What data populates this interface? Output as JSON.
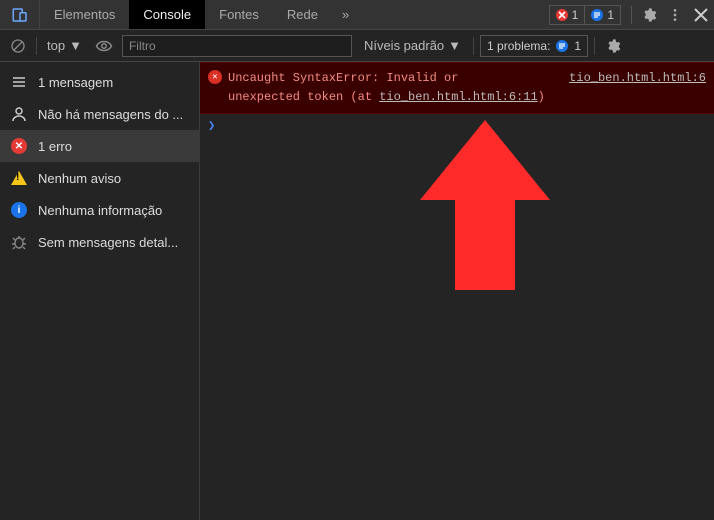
{
  "tabs": {
    "elements": "Elementos",
    "console": "Console",
    "sources": "Fontes",
    "network": "Rede",
    "more": "»"
  },
  "badges": {
    "errors": "1",
    "issues": "1"
  },
  "toolbar": {
    "context": "top",
    "filter_placeholder": "Filtro",
    "levels": "Níveis padrão",
    "issues_label": "1 problema:",
    "issues_count": "1"
  },
  "sidebar": {
    "items": [
      {
        "label": "1 mensagem"
      },
      {
        "label": "Não há mensagens do ..."
      },
      {
        "label": "1 erro"
      },
      {
        "label": "Nenhum aviso"
      },
      {
        "label": "Nenhuma informação"
      },
      {
        "label": "Sem mensagens detal..."
      }
    ]
  },
  "error": {
    "message_line1": "Uncaught SyntaxError: Invalid or",
    "message_line2": "unexpected token (at ",
    "source": "tio_ben.html.html:6",
    "link": "tio_ben.html.html:6:11",
    "tail": ")"
  }
}
